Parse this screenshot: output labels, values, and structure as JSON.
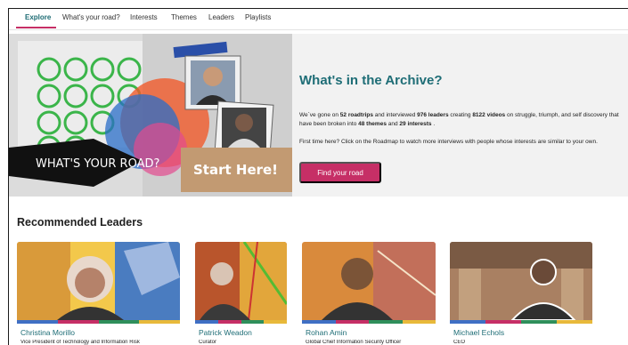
{
  "nav": {
    "items": [
      {
        "label": "Explore",
        "active": true
      },
      {
        "label": "What's your road?",
        "active": false
      },
      {
        "label": "Interests",
        "active": false
      },
      {
        "label": "Themes",
        "active": false
      },
      {
        "label": "Leaders",
        "active": false
      },
      {
        "label": "Playlists",
        "active": false
      }
    ]
  },
  "hero": {
    "collage": {
      "banner_text": "WHAT'S YOUR ROAD?",
      "sign_text": "Start Here!"
    },
    "title": "What's in the Archive?",
    "stats": {
      "p1": "We`ve gone on ",
      "roadtrips": "52 roadtrips",
      "p2": " and interviewed ",
      "leaders": "976 leaders",
      "p3": " creating ",
      "videos": "8122 videos",
      "p4": " on struggle, triumph, and self discovery that have been broken into ",
      "themes": "48 themes",
      "p5": " and ",
      "interests": "29 interests",
      "p6": " ."
    },
    "first_time": "First time here? Click on the Roadmap to watch more interviews with people whose interests are similar to your own.",
    "button_label": "Find your road"
  },
  "recommended": {
    "title": "Recommended Leaders",
    "leaders": [
      {
        "name": "Christina Morillo",
        "role": "Vice President of Technology and Information Risk"
      },
      {
        "name": "Patrick Weadon",
        "role": "Curator"
      },
      {
        "name": "Rohan Amin",
        "role": "Global Chief Information Security Officer"
      },
      {
        "name": "Michael Echols",
        "role": "CEO"
      }
    ]
  },
  "colors": {
    "accent": "#c62f66",
    "teal": "#1e6d76",
    "strip": [
      "#3f6fc4",
      "#c62f66",
      "#2f8f5b",
      "#e8b93a"
    ]
  }
}
